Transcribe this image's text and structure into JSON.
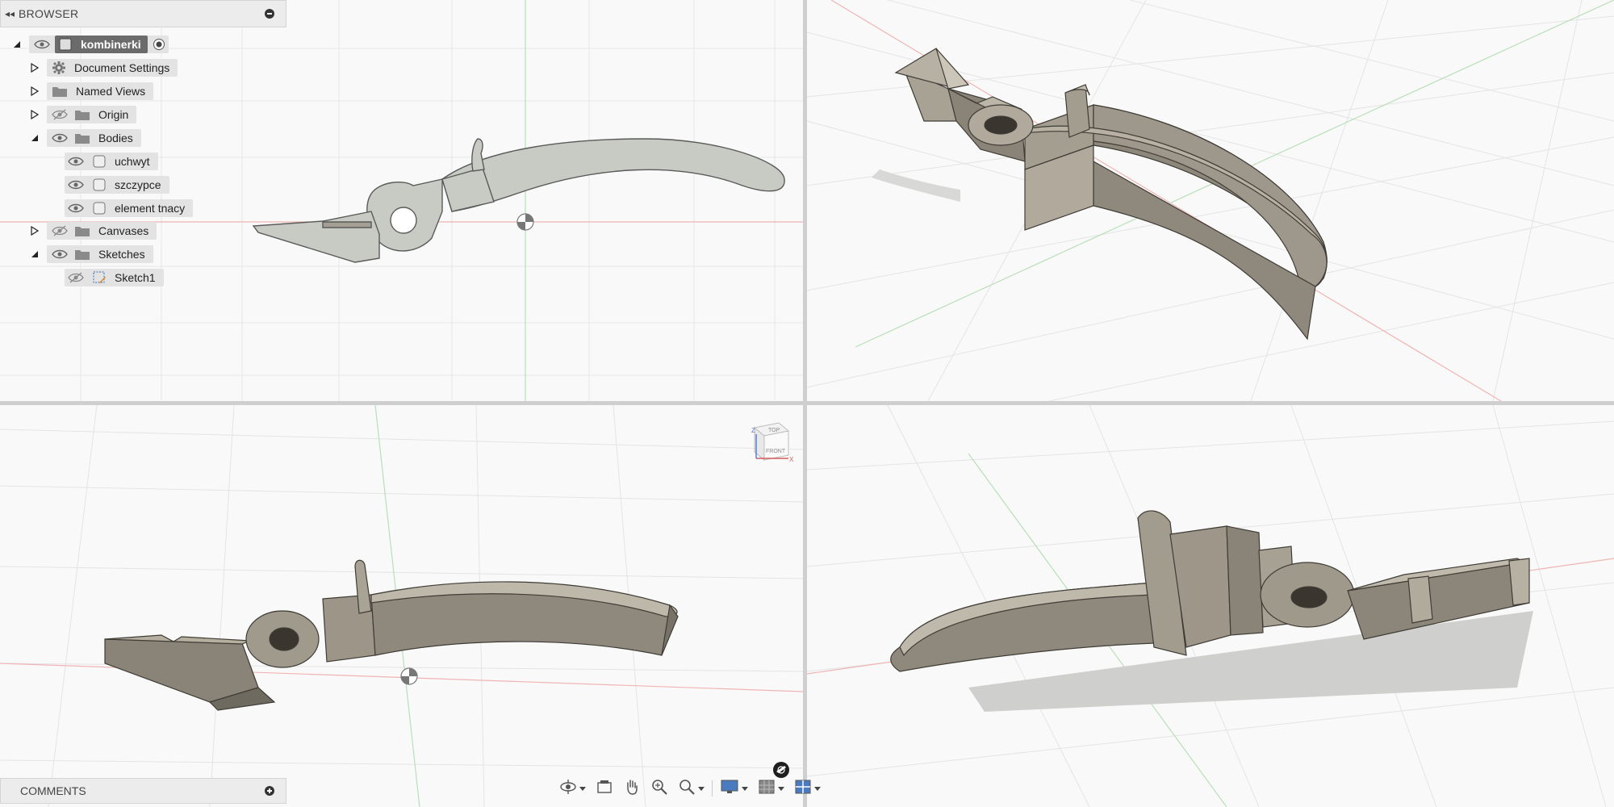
{
  "browser": {
    "title": "BROWSER",
    "collapse_glyph": "◂◂",
    "items": [
      {
        "label": "kombinerki",
        "icon": "document-icon"
      },
      {
        "label": "Document Settings",
        "icon": "gear-icon"
      },
      {
        "label": "Named Views",
        "icon": "folder-icon"
      },
      {
        "label": "Origin",
        "icon": "folder-icon"
      },
      {
        "label": "Bodies",
        "icon": "folder-icon"
      },
      {
        "label": "uchwyt",
        "icon": "body-icon"
      },
      {
        "label": "szczypce",
        "icon": "body-icon"
      },
      {
        "label": "element tnacy",
        "icon": "body-icon"
      },
      {
        "label": "Canvases",
        "icon": "folder-icon"
      },
      {
        "label": "Sketches",
        "icon": "folder-icon"
      },
      {
        "label": "Sketch1",
        "icon": "sketch-icon"
      }
    ]
  },
  "comments": {
    "title": "COMMENTS"
  },
  "viewcube": {
    "top": "TOP",
    "front": "FRONT",
    "axis_x": "X",
    "axis_z": "Z"
  },
  "colors": {
    "model_fill": "#b3ada0",
    "model_dark": "#8f897d",
    "grid_line": "#e2e2e2",
    "x_axis": "#e8a0a0",
    "y_axis": "#a8d8a8",
    "panel_bg": "#ececec"
  },
  "navbar": {
    "buttons": [
      "orbit-icon",
      "look-at-icon",
      "pan-icon",
      "zoom-icon",
      "fit-icon",
      "display-settings-icon",
      "grid-settings-icon",
      "viewports-icon"
    ]
  }
}
